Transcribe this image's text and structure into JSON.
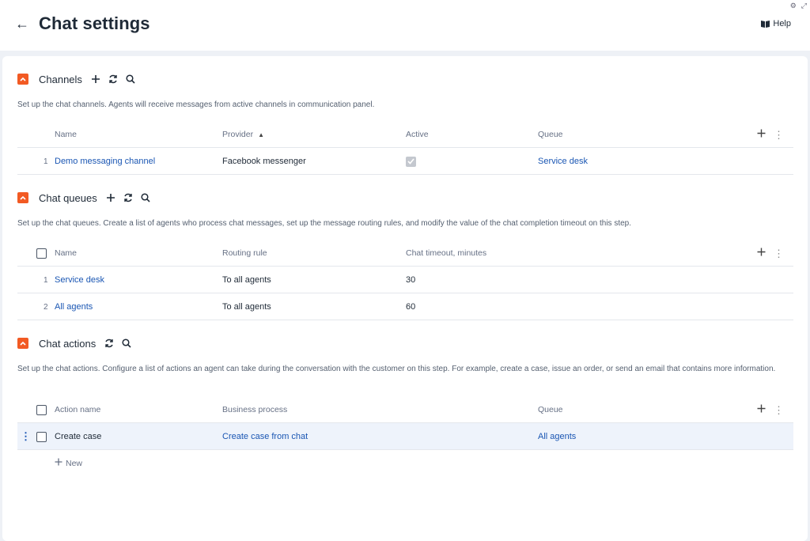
{
  "header": {
    "title": "Chat settings",
    "help_label": "Help",
    "icons": [
      "back-arrow-icon",
      "gear-icon",
      "expand-icon",
      "book-icon"
    ]
  },
  "colors": {
    "accent": "#f25a23",
    "link": "#1a56b3",
    "text": "#1f2a37",
    "muted": "#667085",
    "row_selected": "#eef3fb"
  },
  "channels": {
    "title": "Channels",
    "description": "Set up the chat channels. Agents will receive messages from active channels in communication panel.",
    "columns": [
      "Name",
      "Provider",
      "Active",
      "Queue"
    ],
    "rows": [
      {
        "num": "1",
        "name": "Demo messaging channel",
        "provider": "Facebook messenger",
        "active": true,
        "queue": "Service desk"
      }
    ]
  },
  "queues": {
    "title": "Chat queues",
    "description": "Set up the chat queues. Create a list of agents who process chat messages, set up the message routing rules, and modify the value of the chat completion timeout on this step.",
    "columns": [
      "Name",
      "Routing rule",
      "Chat timeout, minutes"
    ],
    "rows": [
      {
        "num": "1",
        "name": "Service desk",
        "rule": "To all agents",
        "timeout": "30"
      },
      {
        "num": "2",
        "name": "All agents",
        "rule": "To all agents",
        "timeout": "60"
      }
    ]
  },
  "actions": {
    "title": "Chat actions",
    "description": "Set up the chat actions. Configure a list of actions an agent can take during the conversation with the customer on this step. For example, create a case, issue an order, or send an email that contains more information.",
    "columns": [
      "Action name",
      "Business process",
      "Queue"
    ],
    "rows": [
      {
        "name": "Create case",
        "process": "Create case from chat",
        "queue": "All agents"
      }
    ],
    "new_label": "New"
  }
}
